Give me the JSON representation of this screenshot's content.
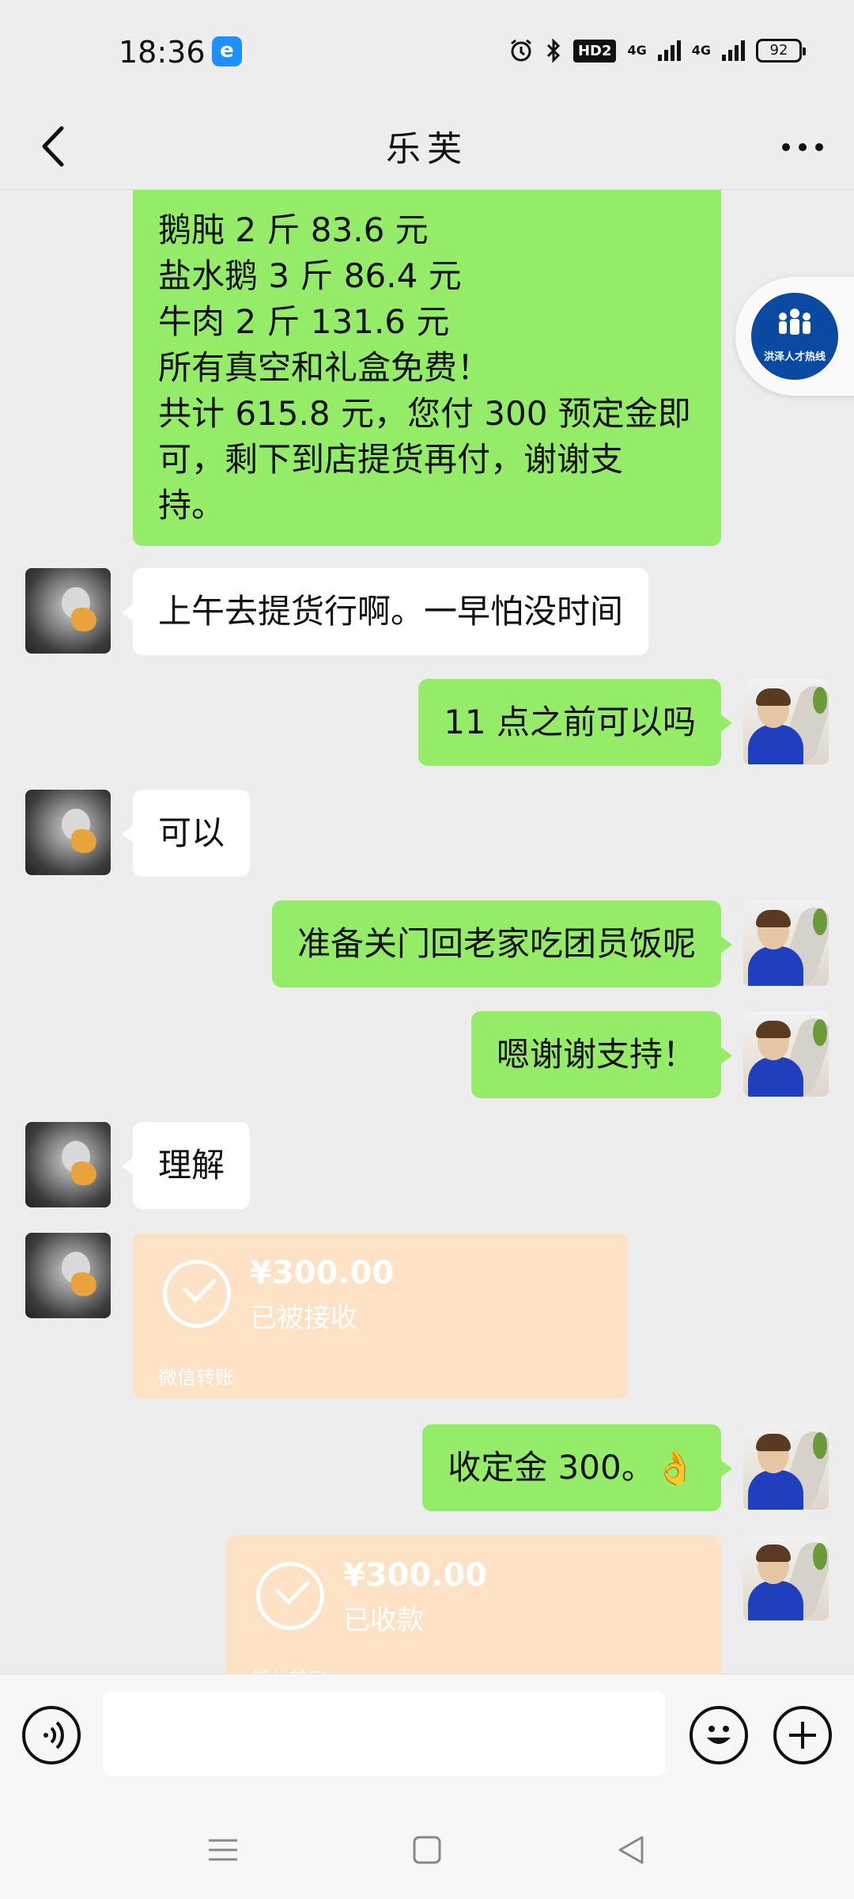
{
  "status": {
    "time": "18:36",
    "hd": "HD2",
    "net1": "4G",
    "net2": "4G",
    "battery": "92"
  },
  "header": {
    "title": "乐芙"
  },
  "messages": {
    "long_text_lines": [
      "鹅肫 2 斤 83.6 元",
      "盐水鹅 3 斤 86.4 元",
      "牛肉 2 斤 131.6 元",
      "所有真空和礼盒免费！",
      "共计 615.8 元，您付 300 预定金即",
      "可，剩下到店提货再付，谢谢支",
      "持。"
    ],
    "m1": "上午去提货行啊。一早怕没时间",
    "m2": "11 点之前可以吗",
    "m3": "可以",
    "m4": "准备关门回老家吃团员饭呢",
    "m5": "嗯谢谢支持！",
    "m6": "理解",
    "m8": "收定金 300。👌"
  },
  "transfers": {
    "t1": {
      "amount": "¥300.00",
      "status": "已被接收",
      "footer": "微信转账"
    },
    "t2": {
      "amount": "¥300.00",
      "status": "已收款",
      "footer": "微信转账"
    }
  },
  "badge": {
    "text": "洪泽人才热线"
  },
  "input": {
    "placeholder": ""
  },
  "colors": {
    "bubble_green": "#95ec69",
    "transfer_bg": "#fde2c6",
    "background": "#ededed"
  }
}
